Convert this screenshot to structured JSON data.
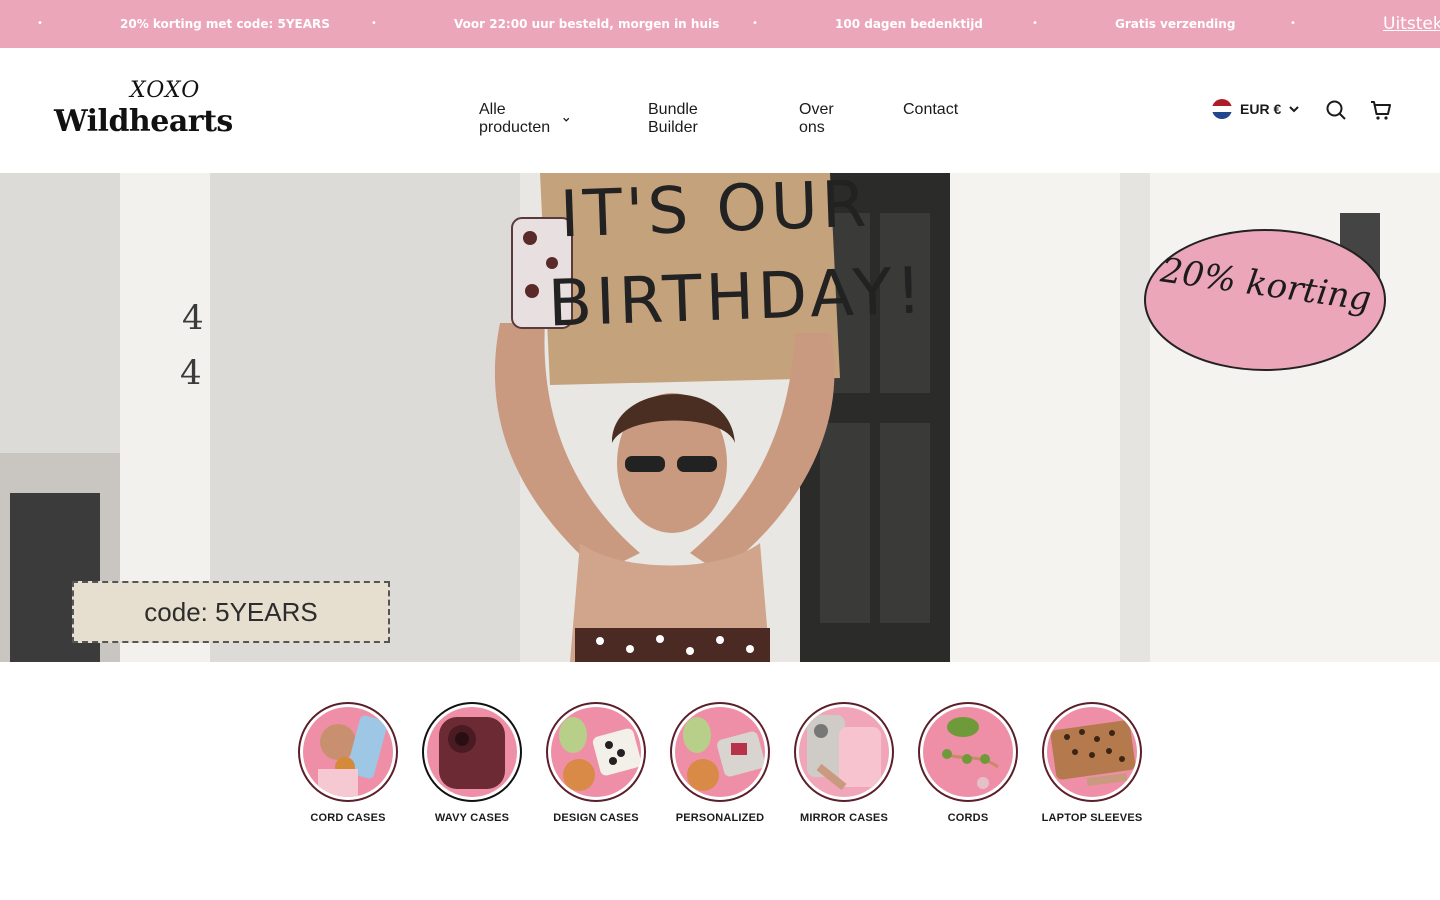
{
  "announcement": {
    "items": [
      "20% korting met code: 5YEARS",
      "Voor 22:00 uur besteld, morgen in huis",
      "100 dagen bedenktijd",
      "Gratis verzending"
    ],
    "separator": "•",
    "more_label": "Uitstek",
    "bg_color": "#eca6ba"
  },
  "header": {
    "logo_small": "XOXO",
    "logo_main": "Wildhearts",
    "nav": [
      "Alle producten",
      "Bundle Builder",
      "Over ons",
      "Contact"
    ],
    "currency": "EUR €",
    "icons": [
      "search-icon",
      "cart-icon"
    ]
  },
  "hero": {
    "sign_line1": "IT'S OUR",
    "sign_line2": "BIRTHDAY!",
    "house_numbers": [
      "4",
      "4"
    ],
    "oval_text": "20% korting",
    "code_text": "code: 5YEARS"
  },
  "categories": [
    {
      "label": "CORD CASES"
    },
    {
      "label": "WAVY CASES"
    },
    {
      "label": "DESIGN CASES"
    },
    {
      "label": "PERSONALIZED"
    },
    {
      "label": "MIRROR CASES"
    },
    {
      "label": "CORDS"
    },
    {
      "label": "LAPTOP SLEEVES"
    }
  ]
}
